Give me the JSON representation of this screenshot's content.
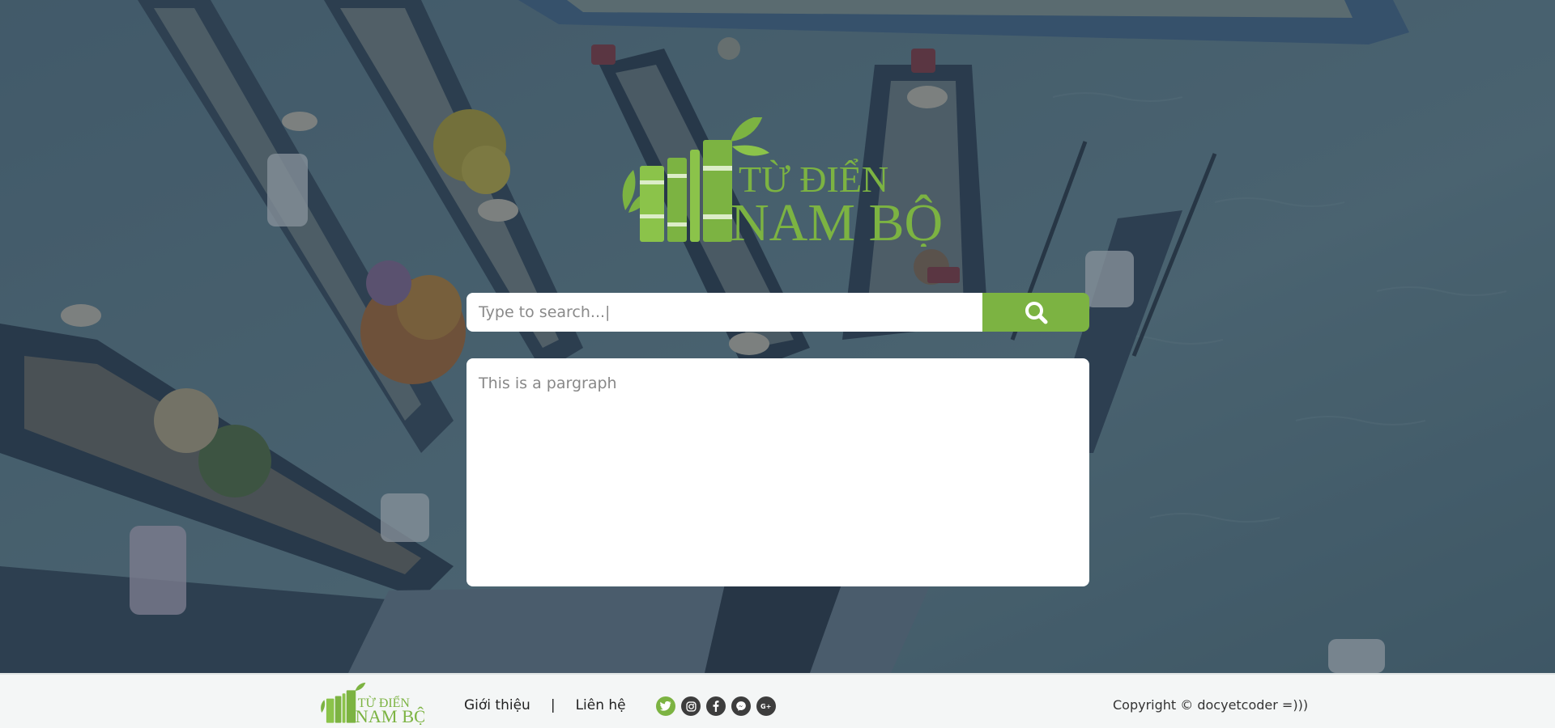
{
  "brand": {
    "line1": "TỪ ĐIỂN",
    "line2": "NAM BỘ",
    "color": "#7cb342"
  },
  "search": {
    "placeholder": "Type to search...|",
    "button_icon": "search-icon",
    "button_color": "#7cb342"
  },
  "content": {
    "paragraph": "This is a pargraph"
  },
  "footer": {
    "links": [
      "Giới thiệu",
      "Liên hệ"
    ],
    "separator": "|",
    "socials": [
      "twitter-icon",
      "instagram-icon",
      "facebook-icon",
      "messenger-icon",
      "google-plus-icon"
    ],
    "copyright": "Copyright © docyetcoder =)))"
  }
}
